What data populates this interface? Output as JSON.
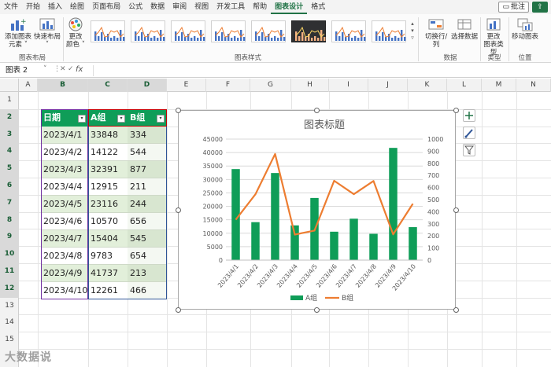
{
  "ribbon": {
    "tabs": [
      "文件",
      "开始",
      "插入",
      "绘图",
      "页面布局",
      "公式",
      "数据",
      "审阅",
      "视图",
      "开发工具",
      "帮助",
      "图表设计",
      "格式"
    ],
    "active_tab": "图表设计",
    "comment_label": "批注",
    "buttons": {
      "add_element": "添加图表\n元素 ˅",
      "quick_layout": "快速布局\n˅",
      "change_color": "更改\n颜色 ˅",
      "switch_row_col": "切换行/列",
      "select_data": "选择数据",
      "change_type": "更改\n图表类型",
      "move_chart": "移动图表"
    },
    "groups": {
      "layout": "图表布局",
      "styles": "图表样式",
      "data": "数据",
      "type": "类型",
      "location": "位置"
    }
  },
  "formula_bar": {
    "name_box": "图表 2",
    "fx": "fx",
    "content": ""
  },
  "grid": {
    "columns": [
      "A",
      "B",
      "C",
      "D",
      "E",
      "F",
      "G",
      "H",
      "I",
      "J",
      "K",
      "L",
      "M",
      "N"
    ],
    "rows": [
      "1",
      "2",
      "3",
      "4",
      "5",
      "6",
      "7",
      "8",
      "9",
      "10",
      "11",
      "12",
      "13",
      "14",
      "15"
    ]
  },
  "table": {
    "headers": [
      "日期",
      "A组",
      "B组"
    ],
    "rows": [
      [
        "2023/4/1",
        "33848",
        "334"
      ],
      [
        "2023/4/2",
        "14122",
        "544"
      ],
      [
        "2023/4/3",
        "32391",
        "877"
      ],
      [
        "2023/4/4",
        "12915",
        "211"
      ],
      [
        "2023/4/5",
        "23116",
        "244"
      ],
      [
        "2023/4/6",
        "10570",
        "656"
      ],
      [
        "2023/4/7",
        "15404",
        "545"
      ],
      [
        "2023/4/8",
        "9783",
        "654"
      ],
      [
        "2023/4/9",
        "41737",
        "213"
      ],
      [
        "2023/4/10",
        "12261",
        "466"
      ]
    ]
  },
  "chart_data": {
    "type": "bar",
    "title": "图表标题",
    "categories": [
      "2023/4/1",
      "2023/4/2",
      "2023/4/3",
      "2023/4/4",
      "2023/4/5",
      "2023/4/6",
      "2023/4/7",
      "2023/4/8",
      "2023/4/9",
      "2023/4/10"
    ],
    "series": [
      {
        "name": "A组",
        "type": "bar",
        "axis": "primary",
        "color": "#0f9d58",
        "values": [
          33848,
          14122,
          32391,
          12915,
          23116,
          10570,
          15404,
          9783,
          41737,
          12261
        ]
      },
      {
        "name": "B组",
        "type": "line",
        "axis": "secondary",
        "color": "#ed7d31",
        "values": [
          334,
          544,
          877,
          211,
          244,
          656,
          545,
          654,
          213,
          466
        ]
      }
    ],
    "ylim": [
      0,
      45000
    ],
    "y_ticks": [
      "0",
      "5000",
      "10000",
      "15000",
      "20000",
      "25000",
      "30000",
      "35000",
      "40000",
      "45000"
    ],
    "y2lim": [
      0,
      1000
    ],
    "y2_ticks": [
      "0",
      "100",
      "200",
      "300",
      "400",
      "500",
      "600",
      "700",
      "800",
      "900",
      "1000"
    ],
    "grid": true,
    "legend": "bottom"
  },
  "watermark": "大数据说"
}
